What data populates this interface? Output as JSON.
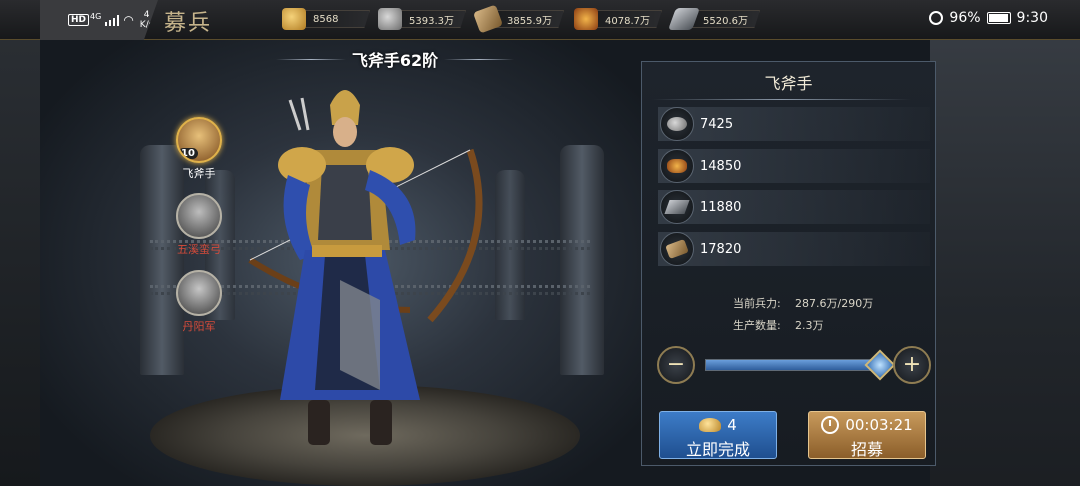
{
  "status_bar": {
    "hd": "HD",
    "network": "4G",
    "speed_value": "4",
    "speed_unit": "K/s",
    "battery": "96%",
    "battery_level": 0.96,
    "time": "9:30"
  },
  "page_title": "募兵",
  "resources": [
    {
      "icon": "gold-ingot-icon",
      "value": "8568"
    },
    {
      "icon": "coin-icon",
      "value": "5393.3万"
    },
    {
      "icon": "wood-icon",
      "value": "3855.9万"
    },
    {
      "icon": "food-icon",
      "value": "4078.7万"
    },
    {
      "icon": "iron-icon",
      "value": "5520.6万"
    }
  ],
  "unit_header": "飞斧手62阶",
  "unit_types": [
    {
      "label": "飞斧手",
      "level": "10",
      "active": true
    },
    {
      "label": "五溪蛮弓",
      "active": false
    },
    {
      "label": "丹阳军",
      "active": false
    }
  ],
  "panel": {
    "title": "飞斧手",
    "costs": [
      {
        "icon": "coin-icon",
        "value": "7425"
      },
      {
        "icon": "food-icon",
        "value": "14850"
      },
      {
        "icon": "iron-icon",
        "value": "11880"
      },
      {
        "icon": "wood-icon",
        "value": "17820"
      }
    ],
    "stats": [
      {
        "label": "当前兵力:",
        "value": "287.6万/290万"
      },
      {
        "label": "生产数量:",
        "value": "2.3万"
      }
    ],
    "slider": {
      "minus": "−",
      "plus": "+",
      "fraction": 0.99
    },
    "complete_button": {
      "cost": "4",
      "label": "立即完成"
    },
    "recruit_button": {
      "time": "00:03:21",
      "label": "招募"
    }
  },
  "colors": {
    "accent_gold": "#e0b24a",
    "complete_blue": "#3d7cc8",
    "recruit_bronze": "#c89a5c",
    "locked_red": "#d64b3a"
  }
}
